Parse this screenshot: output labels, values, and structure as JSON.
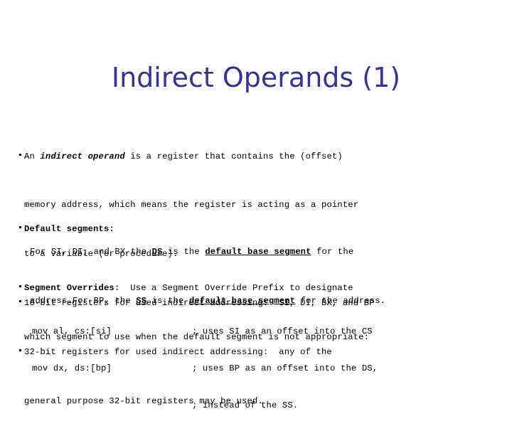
{
  "slide": {
    "title": "Indirect Operands (1)",
    "title_color": "#333399",
    "background_color": "#ffffff",
    "text_color": "#000000"
  },
  "intro": {
    "bullet1": {
      "prefix": "An ",
      "emphasis": "indirect operand",
      "rest": " is a register that contains the (offset)",
      "line2": "memory address, which means the register is acting as a pointer",
      "line3": "to a variable (or procedure)."
    },
    "bullet2": "16-bit registers for used indirect addressing:  SI, DI, BX, and BP",
    "bullet3": {
      "line1": "32-bit registers for used indirect addressing:  any of the",
      "line2": "general purpose 32-bit registers may be used."
    }
  },
  "default_segments": {
    "heading": "Default segments:",
    "line1": {
      "seg_a": "For SI, DI, and BX the ",
      "reg": "DS",
      "seg_b": " is the ",
      "term": "default base segment",
      "seg_c": " for the"
    },
    "line2": {
      "seg_a": "address.For BP, the ",
      "reg": "SS",
      "seg_b": " is the ",
      "term": "default base segment",
      "seg_c": " for the address."
    }
  },
  "segment_overrides": {
    "heading": "Segment Overrides:",
    "line1_rest": "  Use a Segment Override Prefix to designate",
    "line2": "which segment to use when the default segment is not appropriate:"
  },
  "code_example": {
    "instructions": [
      "mov al, cs:[si]",
      "mov dx, ds:[bp]"
    ],
    "comments": [
      "; uses SI as an offset into the CS",
      "; uses BP as an offset into the DS,",
      "; instead of the SS."
    ]
  }
}
